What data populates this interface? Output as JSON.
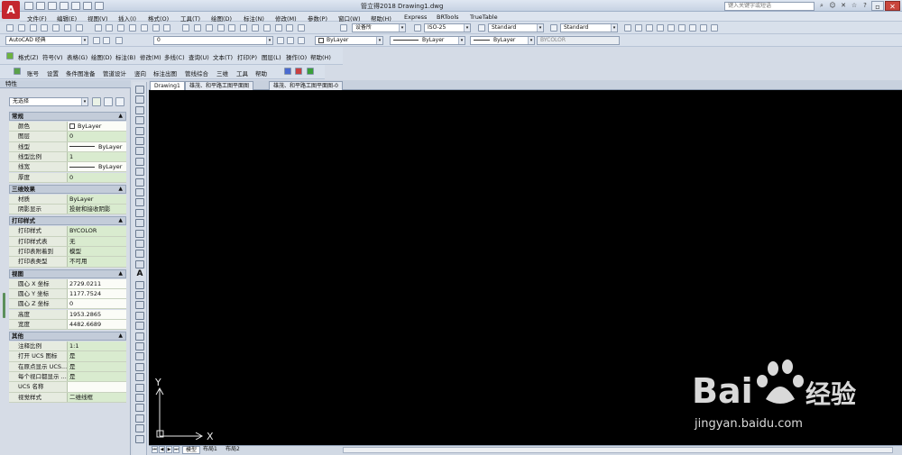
{
  "titlebar": {
    "title": "管立得2018     Drawing1.dwg",
    "search_placeholder": "键入关键字或短语",
    "app_logo": "A"
  },
  "menubar": {
    "items": [
      "文件(F)",
      "编辑(E)",
      "视图(V)",
      "插入(I)",
      "格式(O)",
      "工具(T)",
      "绘图(D)",
      "标注(N)",
      "修改(M)",
      "参数(P)",
      "窗口(W)",
      "帮助(H)",
      "Express",
      "BRTools",
      "TrueTable"
    ]
  },
  "toolbar1": {
    "text_style": "设备所",
    "dim_style": "ISO-25",
    "table_style": "Standard",
    "multileader_style": "Standard"
  },
  "toolbar2": {
    "workspace": "AutoCAD 经典",
    "layer": "0",
    "color": "ByLayer",
    "linetype": "ByLayer",
    "lineweight": "ByLayer",
    "plot_style": "BYCOLOR"
  },
  "toolbar3": {
    "items": [
      "格式(Z)",
      "符号(V)",
      "表格(G)",
      "绘图(D)",
      "标注(B)",
      "修改(M)",
      "多线(C)",
      "查询(U)",
      "文本(T)",
      "打印(P)",
      "图层(L)",
      "操作(O)",
      "帮助(H)"
    ]
  },
  "toolbar4": {
    "items": [
      "账号",
      "设置",
      "条件图准备",
      "管道设计",
      "竖向",
      "标注出图",
      "管线综合",
      "三维",
      "工具",
      "帮助"
    ]
  },
  "properties": {
    "title": "特性",
    "selection": "无选择",
    "sections": [
      {
        "name": "常规",
        "rows": [
          {
            "label": "颜色",
            "value": "ByLayer"
          },
          {
            "label": "图层",
            "value": "0"
          },
          {
            "label": "线型",
            "value": "ByLayer"
          },
          {
            "label": "线型比例",
            "value": "1"
          },
          {
            "label": "线宽",
            "value": "ByLayer"
          },
          {
            "label": "厚度",
            "value": "0"
          }
        ]
      },
      {
        "name": "三维效果",
        "rows": [
          {
            "label": "材质",
            "value": "ByLayer"
          },
          {
            "label": "阴影显示",
            "value": "投射和接收阴影"
          }
        ]
      },
      {
        "name": "打印样式",
        "rows": [
          {
            "label": "打印样式",
            "value": "BYCOLOR"
          },
          {
            "label": "打印样式表",
            "value": "无"
          },
          {
            "label": "打印表附着到",
            "value": "模型"
          },
          {
            "label": "打印表类型",
            "value": "不可用"
          }
        ]
      },
      {
        "name": "视图",
        "rows": [
          {
            "label": "圆心 X 坐标",
            "value": "2729.0211"
          },
          {
            "label": "圆心 Y 坐标",
            "value": "1177.7524"
          },
          {
            "label": "圆心 Z 坐标",
            "value": "0"
          },
          {
            "label": "高度",
            "value": "1953.2865"
          },
          {
            "label": "宽度",
            "value": "4482.6689"
          }
        ]
      },
      {
        "name": "其他",
        "rows": [
          {
            "label": "注释比例",
            "value": "1:1"
          },
          {
            "label": "打开 UCS 图标",
            "value": "是"
          },
          {
            "label": "在原点显示 UCS...",
            "value": "是"
          },
          {
            "label": "每个视口都显示 ...",
            "value": "是"
          },
          {
            "label": "UCS 名称",
            "value": ""
          },
          {
            "label": "视觉样式",
            "value": "二维线框"
          }
        ]
      }
    ]
  },
  "doc_tabs": [
    "Drawing1",
    "雄茂、和平路工图平面图",
    "雄茂、和平路工图平面图-0"
  ],
  "ucs": {
    "x_label": "X",
    "y_label": "Y"
  },
  "layout_tabs": [
    "模型",
    "布局1",
    "布局2"
  ],
  "watermark": {
    "brand": "Bai",
    "brand2": "经验",
    "url": "jingyan.baidu.com"
  }
}
